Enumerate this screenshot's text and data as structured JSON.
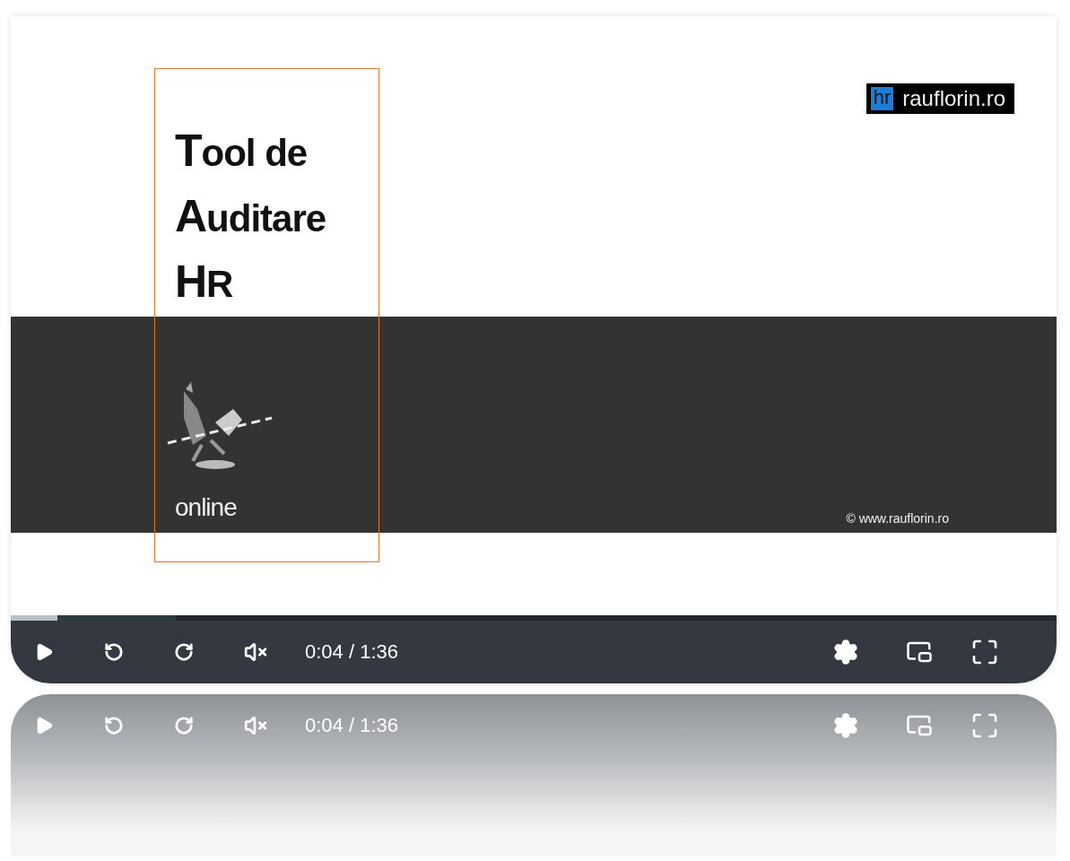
{
  "slide": {
    "title_lines": [
      "Tool de",
      "Auditare",
      "HR"
    ],
    "subtitle": "online",
    "logo": {
      "badge": "hr",
      "text": "rauflorin.ro"
    },
    "copyright": "©  www.rauflorin.ro"
  },
  "player": {
    "progress": {
      "level": 0.045
    },
    "buffer": {
      "level": 0.158
    },
    "time": "0:04 / 1:36",
    "muted": true
  },
  "reflection": {
    "time": "0:04 / 1:36"
  }
}
